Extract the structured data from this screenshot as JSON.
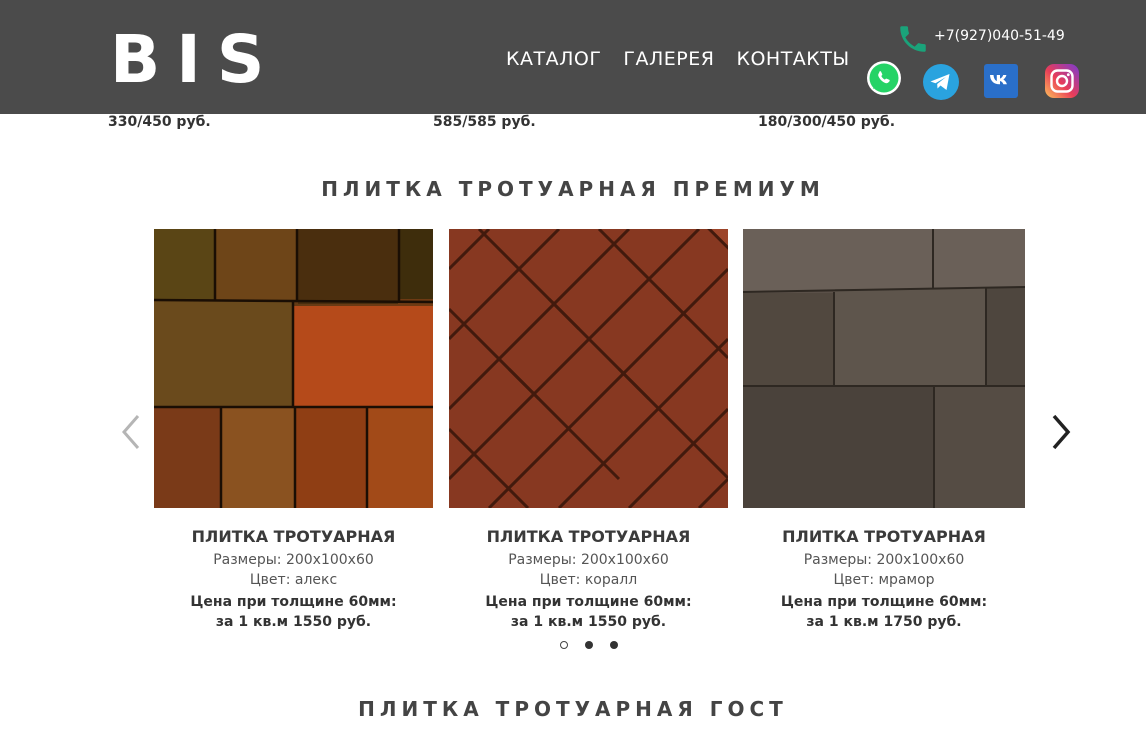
{
  "header": {
    "logo": "BIS",
    "nav": [
      "КАТАЛОГ",
      "ГАЛЕРЕЯ",
      "КОНТАКТЫ"
    ],
    "phone": "+7(927)040-51-49",
    "social_icons": [
      "whatsapp-icon",
      "telegram-icon",
      "vk-icon",
      "instagram-icon"
    ]
  },
  "previous_prices": [
    "330/450 руб.",
    "585/585 руб.",
    "180/300/450 руб."
  ],
  "section_premium": {
    "title": "ПЛИТКА ТРОТУАРНАЯ ПРЕМИУМ"
  },
  "cards": [
    {
      "title": "ПЛИТКА ТРОТУАРНАЯ",
      "size": "Размеры: 200х100х60",
      "color": "Цвет: алекс",
      "price_line1": "Цена при толщине 60мм:",
      "price_line2": "за 1 кв.м 1550 руб."
    },
    {
      "title": "ПЛИТКА ТРОТУАРНАЯ",
      "size": "Размеры: 200х100х60",
      "color": "Цвет: коралл",
      "price_line1": "Цена при толщине 60мм:",
      "price_line2": "за 1 кв.м 1550 руб."
    },
    {
      "title": "ПЛИТКА ТРОТУАРНАЯ",
      "size": "Размеры: 200х100х60",
      "color": "Цвет: мрамор",
      "price_line1": "Цена при толщине 60мм:",
      "price_line2": "за 1 кв.м 1750 руб."
    }
  ],
  "carousel": {
    "pages": 3,
    "active_page": 1
  },
  "section_gost": {
    "title": "ПЛИТКА ТРОТУАРНАЯ ГОСТ"
  },
  "colors": {
    "header_bg": "#4b4b4b",
    "phone_green": "#1aa37a"
  }
}
